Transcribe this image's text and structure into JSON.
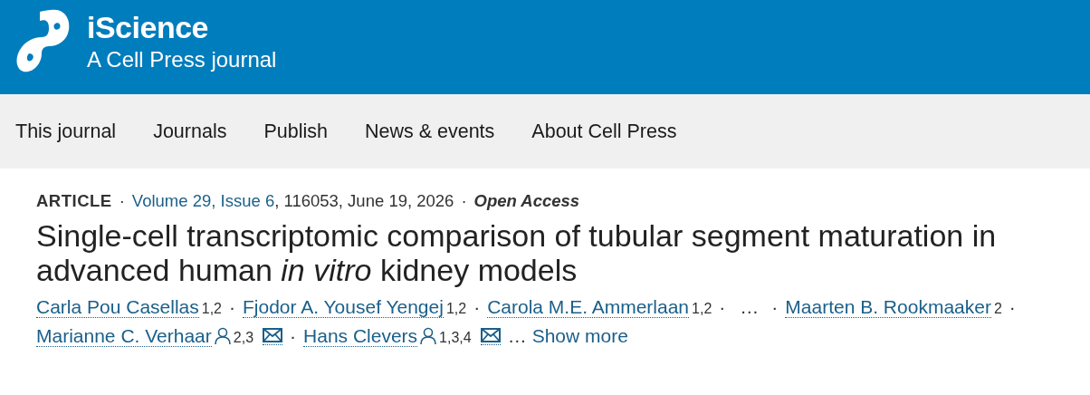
{
  "header": {
    "journal": "iScience",
    "tagline": "A Cell Press journal"
  },
  "nav": [
    {
      "label": "This journal"
    },
    {
      "label": "Journals"
    },
    {
      "label": "Publish"
    },
    {
      "label": "News & events"
    },
    {
      "label": "About Cell Press"
    }
  ],
  "meta": [
    {
      "kind": "type",
      "text": "ARTICLE"
    },
    {
      "kind": "sep",
      "text": "·"
    },
    {
      "kind": "link",
      "text": "Volume 29, Issue 6"
    },
    {
      "kind": "plain",
      "text": ", 116053, June 19, 2026"
    },
    {
      "kind": "sep",
      "text": "·"
    },
    {
      "kind": "access",
      "text": "Open Access"
    }
  ],
  "title": "Single-cell transcriptomic comparison of tubular segment maturation in advanced human *in vitro* kidney models",
  "author_lines": [
    [
      {
        "kind": "author",
        "name": "Carla Pou Casellas",
        "affiliations": "1,2",
        "corresponding": false,
        "email": false
      },
      {
        "kind": "sep",
        "text": "·"
      },
      {
        "kind": "author",
        "name": "Fjodor A. Yousef Yengej",
        "affiliations": "1,2",
        "corresponding": false,
        "email": false
      },
      {
        "kind": "sep",
        "text": "·"
      },
      {
        "kind": "author",
        "name": "Carola M.E. Ammerlaan",
        "affiliations": "1,2",
        "corresponding": false,
        "email": false
      },
      {
        "kind": "sep",
        "text": "·"
      },
      {
        "kind": "ellipsis",
        "text": "…"
      },
      {
        "kind": "sep",
        "text": "·"
      },
      {
        "kind": "author",
        "name": "Maarten B. Rookmaaker",
        "affiliations": "2",
        "corresponding": false,
        "email": false
      },
      {
        "kind": "sep",
        "text": "·"
      }
    ],
    [
      {
        "kind": "author",
        "name": "Marianne C. Verhaar",
        "affiliations": "2,3",
        "corresponding": true,
        "email": true
      },
      {
        "kind": "sep",
        "text": "·"
      },
      {
        "kind": "author",
        "name": "Hans Clevers",
        "affiliations": "1,3,4",
        "corresponding": true,
        "email": true
      },
      {
        "kind": "ellipsis",
        "text": "…"
      },
      {
        "kind": "more",
        "text": "Show more"
      }
    ]
  ]
}
